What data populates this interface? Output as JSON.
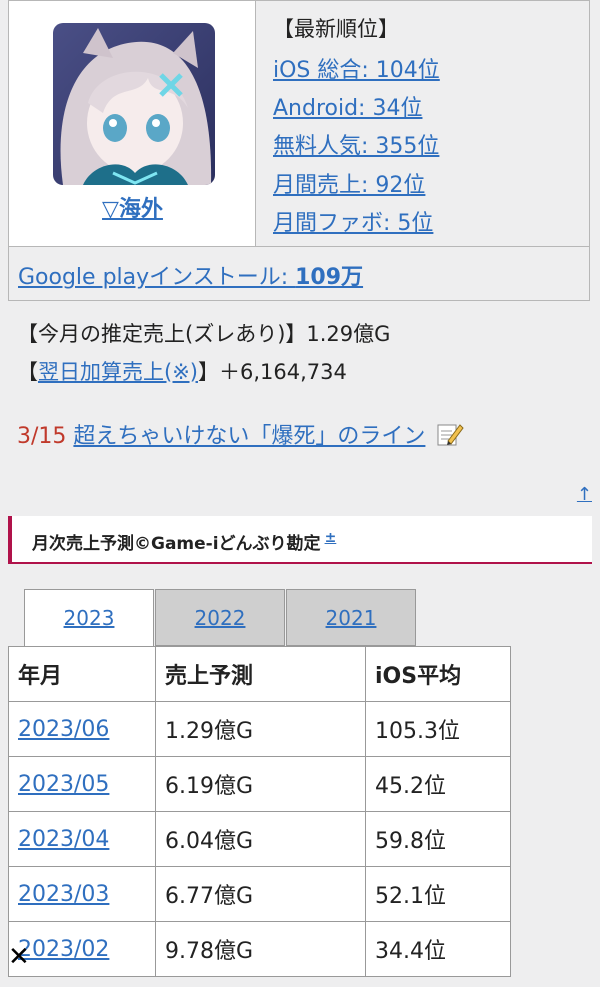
{
  "info": {
    "overseas_link": "▽海外",
    "rank_title": "【最新順位】",
    "ranks": [
      "iOS 総合: 104位",
      "Android: 34位",
      "無料人気: 355位",
      "月間売上: 92位",
      "月間ファボ: 5位"
    ],
    "install_label": "Google playインストール: ",
    "install_value": "109万"
  },
  "sales": {
    "monthly_estimate": "【今月の推定売上(ズレあり)】1.29億G",
    "next_day_open": "【",
    "next_day_link": "翌日加算売上(※)",
    "next_day_close": "】＋6,164,734"
  },
  "event": {
    "date": "3/15",
    "link": "超えちゃいけない「爆死」のライン"
  },
  "nav": {
    "up_arrow": "↑"
  },
  "section": {
    "title": "月次売上予測©Game-iどんぶり勘定",
    "plus": "±"
  },
  "tabs": [
    "2023",
    "2022",
    "2021"
  ],
  "table": {
    "headers": [
      "年月",
      "売上予測",
      "iOS平均"
    ],
    "rows": [
      [
        "2023/06",
        "1.29億G",
        "105.3位"
      ],
      [
        "2023/05",
        "6.19億G",
        "45.2位"
      ],
      [
        "2023/04",
        "6.04億G",
        "59.8位"
      ],
      [
        "2023/03",
        "6.77億G",
        "52.1位"
      ],
      [
        "2023/02",
        "9.78億G",
        "34.4位"
      ]
    ]
  },
  "close": "✕"
}
